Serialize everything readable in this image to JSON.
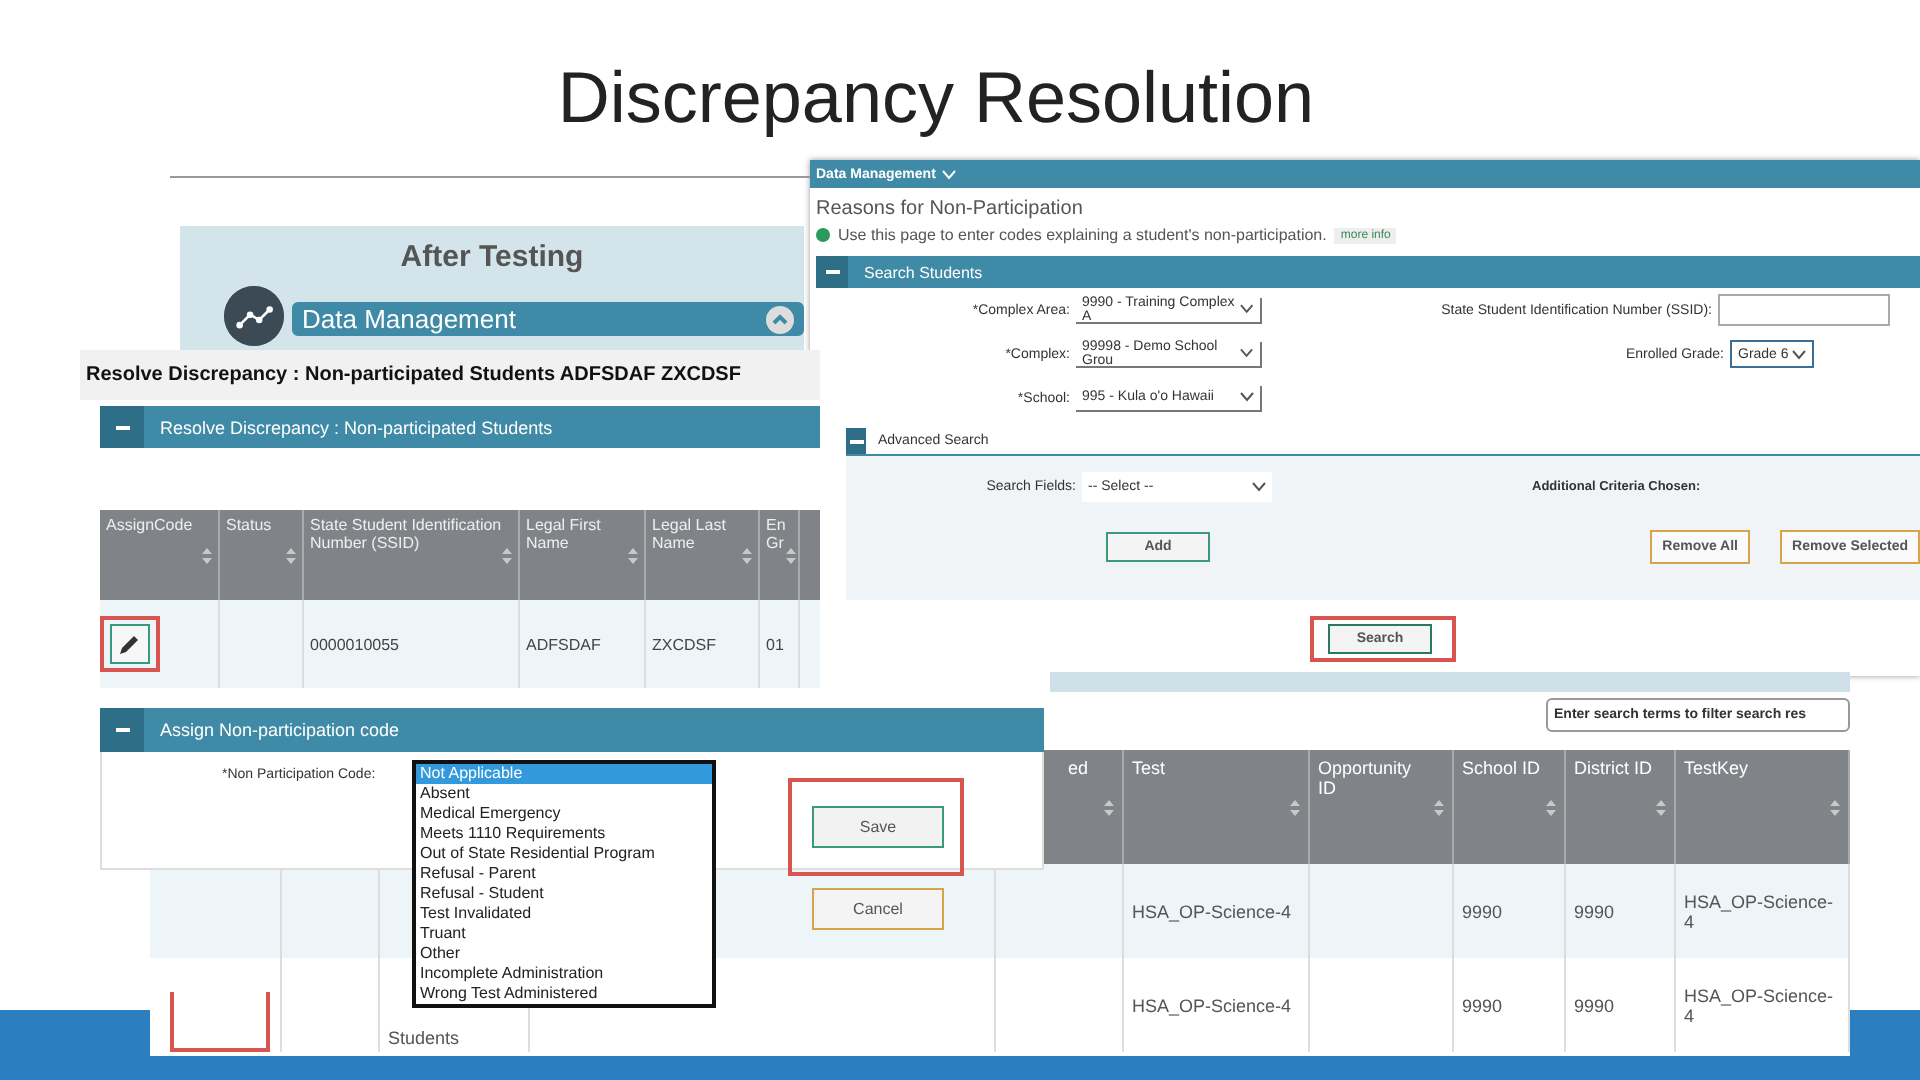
{
  "slide": {
    "title": "Discrepancy Resolution"
  },
  "after_testing": {
    "title": "After Testing",
    "button": "Data Management"
  },
  "search_window": {
    "menu": "Data Management",
    "heading": "Reasons for Non-Participation",
    "info": "Use this page to enter codes explaining a student's non-participation.",
    "more_info": "more info",
    "section": "Search Students",
    "fields": [
      {
        "label": "*Complex Area:",
        "value": "9990 - Training Complex A"
      },
      {
        "label": "*Complex:",
        "value": "99998 - Demo School Grou"
      },
      {
        "label": "*School:",
        "value": "995 - Kula o'o Hawaii"
      }
    ],
    "ssid_label": "State Student Identification Number (SSID):",
    "grade": {
      "label": "Enrolled Grade:",
      "value": "Grade 6"
    },
    "advanced": {
      "title": "Advanced Search",
      "fields_label": "Search Fields:",
      "fields_value": "-- Select --",
      "criteria_label": "Additional Criteria Chosen:",
      "add": "Add",
      "remove_all": "Remove All",
      "remove_selected": "Remove Selected"
    },
    "search_button": "Search"
  },
  "results": {
    "filter_placeholder": "Enter search terms to filter search res",
    "columns": [
      "ed",
      "Test",
      "Opportunity ID",
      "School ID",
      "District ID",
      "TestKey"
    ],
    "rows": [
      {
        "test": "HSA_OP-Science-4",
        "school_id": "9990",
        "district_id": "9990",
        "test_key": "HSA_OP-Science-4"
      },
      {
        "name": "Students",
        "test": "HSA_OP-Science-4",
        "school_id": "9990",
        "district_id": "9990",
        "test_key": "HSA_OP-Science-4"
      }
    ]
  },
  "dialog": {
    "title": "Resolve Discrepancy : Non-participated Students ADFSDAF ZXCDSF",
    "section": "Resolve Discrepancy : Non-participated Students",
    "columns": [
      "AssignCode",
      "Status",
      "State Student Identification Number (SSID)",
      "Legal First Name",
      "Legal Last Name",
      "En Gr"
    ],
    "row": {
      "ssid": "0000010055",
      "first": "ADFSDAF",
      "last": "ZXCDSF",
      "grade": "01"
    },
    "assign": {
      "title": "Assign Non-participation code",
      "label": "*Non Participation Code:",
      "options": [
        {
          "label": "Not Applicable",
          "selected": true
        },
        {
          "label": "Absent",
          "selected": false
        },
        {
          "label": "Medical Emergency",
          "selected": false
        },
        {
          "label": "Meets 1110 Requirements",
          "selected": false
        },
        {
          "label": "Out of State Residential Program",
          "selected": false
        },
        {
          "label": "Refusal - Parent",
          "selected": false
        },
        {
          "label": "Refusal - Student",
          "selected": false
        },
        {
          "label": "Test Invalidated",
          "selected": false
        },
        {
          "label": "Truant",
          "selected": false
        },
        {
          "label": "Other",
          "selected": false
        },
        {
          "label": "Incomplete Administration",
          "selected": false
        },
        {
          "label": "Wrong Test Administered",
          "selected": false
        }
      ],
      "save": "Save",
      "cancel": "Cancel"
    }
  }
}
